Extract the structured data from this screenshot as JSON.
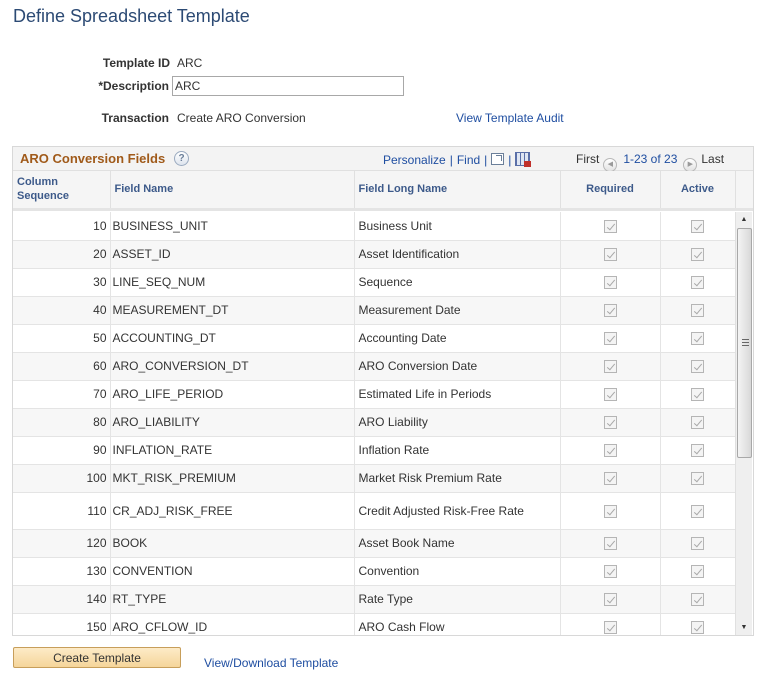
{
  "page": {
    "title": "Define Spreadsheet Template"
  },
  "form": {
    "template_id_label": "Template ID",
    "template_id_value": "ARC",
    "description_label": "*Description",
    "description_value": "ARC",
    "transaction_label": "Transaction",
    "transaction_value": "Create ARO Conversion",
    "audit_link": "View Template Audit"
  },
  "grid": {
    "title": "ARO Conversion Fields",
    "help_icon": "question-mark",
    "personalize": "Personalize",
    "find": "Find",
    "zoom_icon": "new-window-icon",
    "download_icon": "download-to-excel-icon",
    "nav_first": "First",
    "nav_count": "1-23 of 23",
    "nav_last": "Last",
    "columns": {
      "seq_line1": "Column",
      "seq_line2": "Sequence",
      "field_name": "Field Name",
      "field_long_name": "Field Long Name",
      "required": "Required",
      "active": "Active"
    },
    "rows": [
      {
        "seq": "10",
        "field": "BUSINESS_UNIT",
        "long": "Business Unit",
        "required": true,
        "active": true
      },
      {
        "seq": "20",
        "field": "ASSET_ID",
        "long": "Asset Identification",
        "required": true,
        "active": true
      },
      {
        "seq": "30",
        "field": "LINE_SEQ_NUM",
        "long": "Sequence",
        "required": true,
        "active": true
      },
      {
        "seq": "40",
        "field": "MEASUREMENT_DT",
        "long": "Measurement Date",
        "required": true,
        "active": true
      },
      {
        "seq": "50",
        "field": "ACCOUNTING_DT",
        "long": "Accounting Date",
        "required": true,
        "active": true
      },
      {
        "seq": "60",
        "field": "ARO_CONVERSION_DT",
        "long": "ARO Conversion Date",
        "required": true,
        "active": true
      },
      {
        "seq": "70",
        "field": "ARO_LIFE_PERIOD",
        "long": "Estimated Life in Periods",
        "required": true,
        "active": true
      },
      {
        "seq": "80",
        "field": "ARO_LIABILITY",
        "long": "ARO Liability",
        "required": true,
        "active": true
      },
      {
        "seq": "90",
        "field": "INFLATION_RATE",
        "long": "Inflation Rate",
        "required": true,
        "active": true
      },
      {
        "seq": "100",
        "field": "MKT_RISK_PREMIUM",
        "long": "Market Risk Premium Rate",
        "required": true,
        "active": true
      },
      {
        "seq": "110",
        "field": "CR_ADJ_RISK_FREE",
        "long": "Credit Adjusted Risk-Free Rate",
        "required": true,
        "active": true
      },
      {
        "seq": "120",
        "field": "BOOK",
        "long": "Asset Book Name",
        "required": true,
        "active": true
      },
      {
        "seq": "130",
        "field": "CONVENTION",
        "long": "Convention",
        "required": true,
        "active": true
      },
      {
        "seq": "140",
        "field": "RT_TYPE",
        "long": "Rate Type",
        "required": true,
        "active": true
      },
      {
        "seq": "150",
        "field": "ARO_CFLOW_ID",
        "long": "ARO Cash Flow",
        "required": true,
        "active": true
      }
    ]
  },
  "footer": {
    "create_button": "Create Template",
    "download_link": "View/Download Template"
  }
}
